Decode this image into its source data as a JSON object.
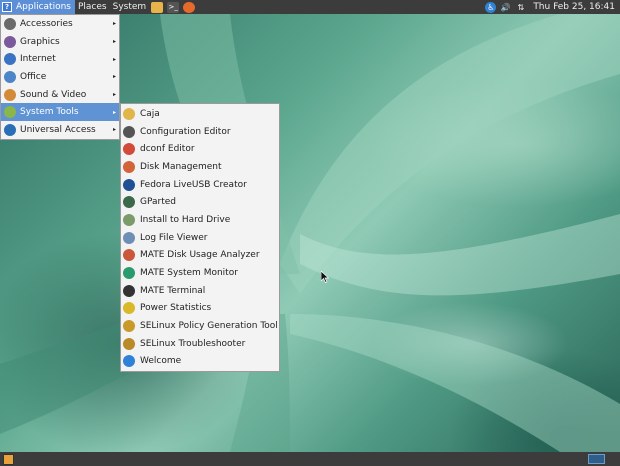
{
  "top_panel": {
    "applications_label": "Applications",
    "places_label": "Places",
    "system_label": "System",
    "clock": "Thu Feb 25, 16:41",
    "launchers": [
      {
        "icon": "folder-icon",
        "color": "#e7b34a"
      },
      {
        "icon": "terminal-icon",
        "color": "#555555"
      },
      {
        "icon": "firefox-icon",
        "color": "#e66a2b"
      }
    ]
  },
  "main_menu": {
    "items": [
      {
        "label": "Accessories",
        "icon": "accessories-icon",
        "color": "#6a6a6a",
        "selected": false
      },
      {
        "label": "Graphics",
        "icon": "graphics-icon",
        "color": "#7a5a9a",
        "selected": false
      },
      {
        "label": "Internet",
        "icon": "internet-icon",
        "color": "#3a73c4",
        "selected": false
      },
      {
        "label": "Office",
        "icon": "office-icon",
        "color": "#4b86c9",
        "selected": false
      },
      {
        "label": "Sound & Video",
        "icon": "sound-video-icon",
        "color": "#d38b3a",
        "selected": false
      },
      {
        "label": "System Tools",
        "icon": "system-tools-icon",
        "color": "#8bb64a",
        "selected": true
      },
      {
        "label": "Universal Access",
        "icon": "accessibility-icon",
        "color": "#2a6fb5",
        "selected": false
      }
    ]
  },
  "sub_menu": {
    "items": [
      {
        "label": "Caja",
        "icon": "caja-icon",
        "color": "#e0b54a"
      },
      {
        "label": "Configuration Editor",
        "icon": "config-editor-icon",
        "color": "#555555"
      },
      {
        "label": "dconf Editor",
        "icon": "dconf-icon",
        "color": "#d24a3a"
      },
      {
        "label": "Disk Management",
        "icon": "disk-management-icon",
        "color": "#d3643a"
      },
      {
        "label": "Fedora LiveUSB Creator",
        "icon": "liveusb-icon",
        "color": "#1f4f94"
      },
      {
        "label": "GParted",
        "icon": "gparted-icon",
        "color": "#3a6a4a"
      },
      {
        "label": "Install to Hard Drive",
        "icon": "install-icon",
        "color": "#7b9b6a"
      },
      {
        "label": "Log File Viewer",
        "icon": "log-viewer-icon",
        "color": "#6e8fb5"
      },
      {
        "label": "MATE Disk Usage Analyzer",
        "icon": "disk-usage-icon",
        "color": "#c9583a"
      },
      {
        "label": "MATE System Monitor",
        "icon": "system-monitor-icon",
        "color": "#2b9a6c"
      },
      {
        "label": "MATE Terminal",
        "icon": "terminal-icon",
        "color": "#333333"
      },
      {
        "label": "Power Statistics",
        "icon": "power-icon",
        "color": "#d9b82a"
      },
      {
        "label": "SELinux Policy Generation Tool",
        "icon": "selinux-policy-icon",
        "color": "#c79a2a"
      },
      {
        "label": "SELinux Troubleshooter",
        "icon": "selinux-troubleshooter-icon",
        "color": "#b88a2a"
      },
      {
        "label": "Welcome",
        "icon": "welcome-icon",
        "color": "#2f82d6"
      }
    ]
  }
}
